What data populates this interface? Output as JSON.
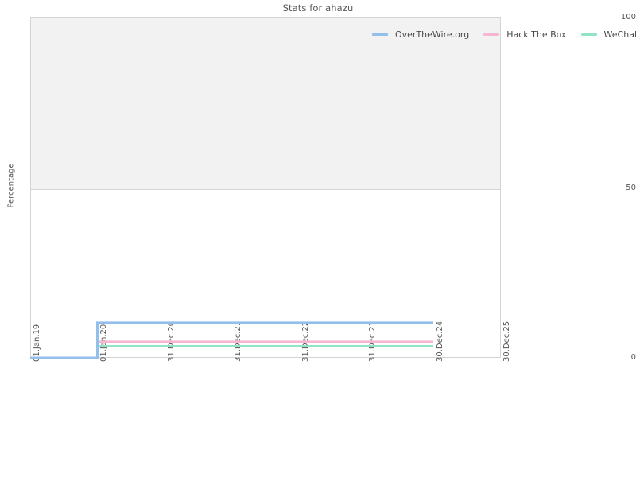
{
  "chart_data": {
    "type": "line",
    "title": "Stats for ahazu",
    "xlabel": "",
    "ylabel": "Percentage",
    "ylim": [
      0,
      100
    ],
    "yticks": [
      0,
      50,
      100
    ],
    "ytick_labels": [
      "0",
      "50",
      "100"
    ],
    "grid": false,
    "legend_position": "top-right",
    "x": [
      "01.Jan.19",
      "01.Jan.20",
      "31.Dec.20",
      "31.Dec.21",
      "31.Dec.22",
      "31.Dec.23",
      "30.Dec.24",
      "30.Dec.25"
    ],
    "xtick_labels": [
      "01.Jan.19",
      "01.Jan.20",
      "31.Dec.20",
      "31.Dec.21",
      "31.Dec.22",
      "31.Dec.23",
      "30.Dec.24",
      "30.Dec.25"
    ],
    "series": [
      {
        "name": "OverTheWire.org",
        "color": "#92bfec",
        "values": [
          0,
          10.3,
          10.3,
          10.3,
          10.3,
          10.3,
          10.3,
          null
        ]
      },
      {
        "name": "Hack The Box",
        "color": "#f7b6d2",
        "values": [
          0,
          4.7,
          4.7,
          4.7,
          4.7,
          4.7,
          4.7,
          null
        ]
      },
      {
        "name": "WeChall",
        "color": "#93e3c5",
        "values": [
          0,
          3.4,
          3.4,
          3.4,
          3.4,
          3.4,
          3.4,
          null
        ]
      }
    ]
  },
  "legend": {
    "entries": [
      {
        "label": "OverTheWire.org",
        "color": "#92bfec"
      },
      {
        "label": "Hack The Box",
        "color": "#f7b6d2"
      },
      {
        "label": "WeChall",
        "color": "#93e3c5"
      }
    ]
  },
  "colors": {
    "background": "#ffffff",
    "plot_band": "#f2f2f2",
    "axis": "#d4d4d4",
    "text": "#555555"
  }
}
